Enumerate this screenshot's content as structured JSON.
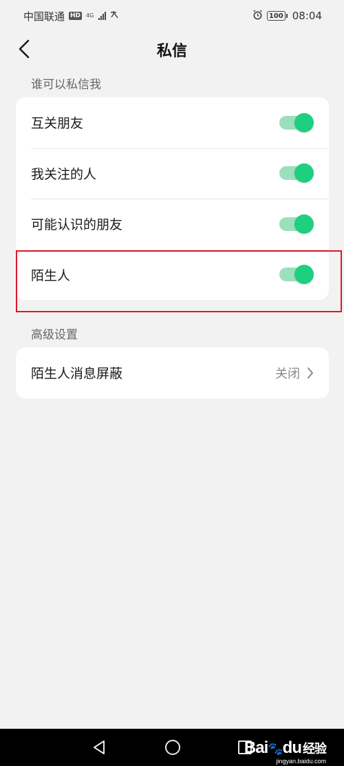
{
  "status_bar": {
    "carrier": "中国联通",
    "hd": "HD",
    "network": "4G",
    "battery": "100",
    "time": "08:04"
  },
  "nav": {
    "title": "私信"
  },
  "section_who": {
    "label": "谁可以私信我",
    "items": [
      {
        "label": "互关朋友",
        "enabled": true
      },
      {
        "label": "我关注的人",
        "enabled": true
      },
      {
        "label": "可能认识的朋友",
        "enabled": true
      },
      {
        "label": "陌生人",
        "enabled": true
      }
    ]
  },
  "section_advanced": {
    "label": "高级设置",
    "items": [
      {
        "label": "陌生人消息屏蔽",
        "value": "关闭"
      }
    ]
  },
  "colors": {
    "toggle_on": "#1dcf7e",
    "toggle_track": "#9be0bd",
    "highlight": "#d9162c"
  },
  "watermark": {
    "brand": "Bai",
    "brand2": "du",
    "cn": "经验",
    "url": "jingyan.baidu.com"
  }
}
